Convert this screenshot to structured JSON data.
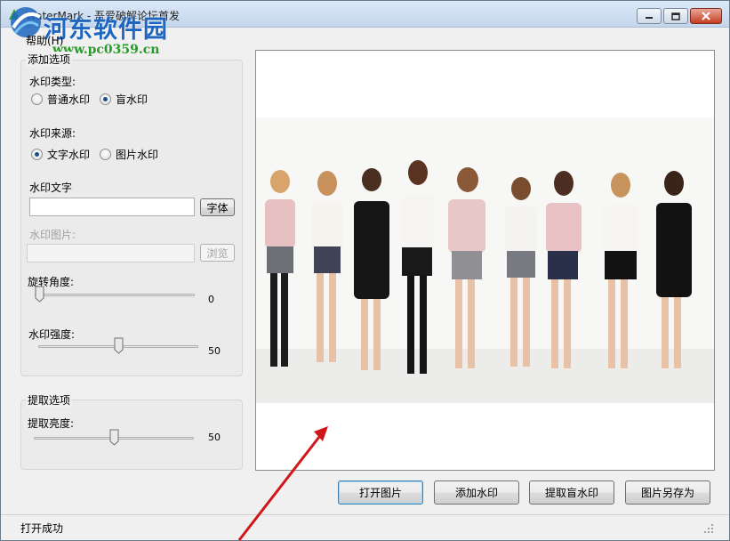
{
  "window": {
    "title": "WaterMark - 吾爱破解论坛首发",
    "watermark_site_name": "河东软件园",
    "watermark_site_url": "www.pc0359.cn"
  },
  "menu": {
    "help": "帮助(H)"
  },
  "add_options": {
    "group_title": "添加选项",
    "watermark_type_label": "水印类型:",
    "type_normal": "普通水印",
    "type_blind": "盲水印",
    "type_selected": "盲水印",
    "watermark_source_label": "水印来源:",
    "source_text": "文字水印",
    "source_image": "图片水印",
    "source_selected": "文字水印",
    "watermark_text_label": "水印文字",
    "watermark_text_value": "",
    "font_button": "字体",
    "watermark_image_label": "水印图片:",
    "watermark_image_value": "",
    "browse_button": "浏览",
    "rotation_label": "旋转角度:",
    "rotation_value": "0",
    "strength_label": "水印强度:",
    "strength_value": "50"
  },
  "extract_options": {
    "group_title": "提取选项",
    "brightness_label": "提取亮度:",
    "brightness_value": "50"
  },
  "actions": {
    "open_image": "打开图片",
    "add_watermark": "添加水印",
    "extract_blind": "提取盲水印",
    "save_as": "图片另存为"
  },
  "status": {
    "text": "打开成功"
  },
  "colors": {
    "accent": "#1b4f8c",
    "arrow": "#d0161a",
    "watermark_blue": "#1f66c0"
  }
}
